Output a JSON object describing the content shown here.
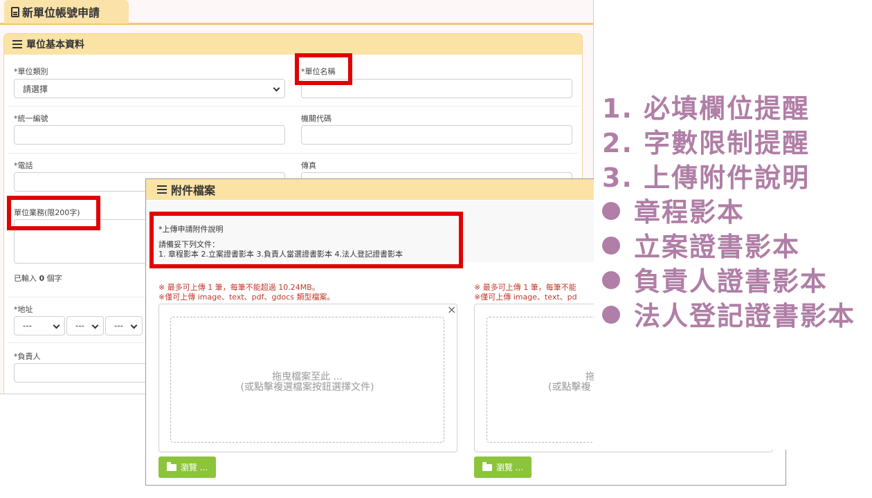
{
  "page_tab": {
    "title": "新單位帳號申請"
  },
  "basic_section": {
    "title": "單位基本資料",
    "fields": {
      "unit_type_label": "*單位類別",
      "unit_type_value": "請選擇",
      "unit_name_label": "*單位名稱",
      "tax_id_label": "*統一編號",
      "agency_code_label": "機關代碼",
      "phone_label": "*電話",
      "fax_label": "傳真",
      "business_label": "單位業務(限200字)",
      "char_count_prefix": "已輸入",
      "char_count_value": "0",
      "char_count_suffix": "個字",
      "address_label": "*地址",
      "address_placeholder": "---",
      "owner_label": "*負責人"
    }
  },
  "attachment_section": {
    "title": "附件檔案",
    "info_title": "*上傳申請附件說明",
    "info_line1": "請備妥下列文件：",
    "info_line2": "1. 章程影本 2.立案證書影本 3.負責人當選證書影本 4.法人登記證書影本",
    "upload_note_1": "※ 最多可上傳 1 筆，每筆不能超過 10.24MB。",
    "upload_note_2": "※僅可上傳 image、text、pdf、gdocs 類型檔案。",
    "upload_note_1_partial": "※ 最多可上傳 1 筆，每筆不能",
    "upload_note_2_partial": "※僅可上傳 image、text、pd",
    "drop_text_1": "拖曳檔案至此 ...",
    "drop_text_2": "(或點擊複選檔案按鈕選擇文件)",
    "drop_text_1_partial": "拖",
    "drop_text_2_partial": "(或點擊複",
    "close_symbol": "×",
    "browse_label": "瀏覽 ..."
  },
  "legend": {
    "items": [
      "1.  必填欄位提醒",
      "2.  字數限制提醒",
      "3.  上傳附件說明",
      "章程影本",
      "立案證書影本",
      "負責人證書影本",
      "法人登記證書影本"
    ]
  },
  "colors": {
    "highlight": "#e00000",
    "accent": "#fbe3a6",
    "legend_text": "#b07ea6",
    "button": "#8cc43c",
    "note_text": "#c0392b"
  },
  "icons": [
    "document-icon",
    "menu-icon",
    "chevron-down-icon",
    "close-icon",
    "folder-open-icon",
    "bullet-dot-icon"
  ]
}
